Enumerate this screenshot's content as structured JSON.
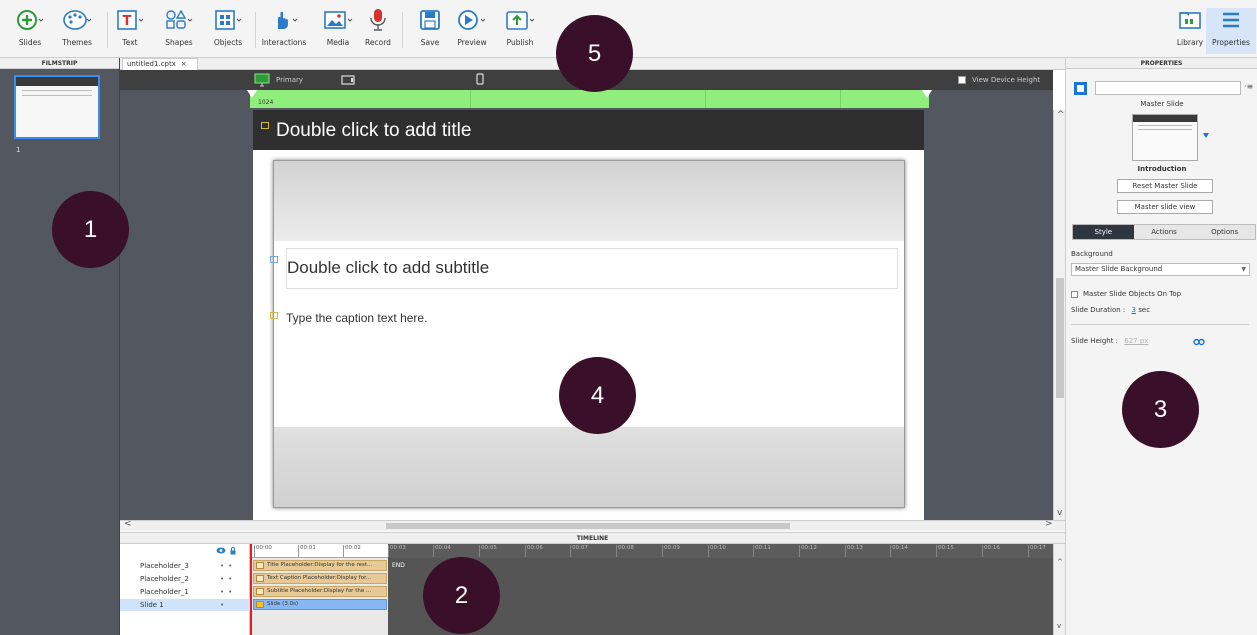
{
  "toolbar": {
    "slides": "Slides",
    "themes": "Themes",
    "text": "Text",
    "shapes": "Shapes",
    "objects": "Objects",
    "interactions": "Interactions",
    "media": "Media",
    "record": "Record",
    "save": "Save",
    "preview": "Preview",
    "publish": "Publish",
    "library": "Library",
    "properties": "Properties"
  },
  "filmstrip": {
    "header": "FILMSTRIP",
    "slide_number": "1"
  },
  "document_tab": {
    "name": "untitled1.cptx",
    "close": "×"
  },
  "device_bar": {
    "primary": "Primary",
    "view_device_height": "View Device Height",
    "width_label": "1024"
  },
  "slide": {
    "title_placeholder": "Double click to add title",
    "subtitle_placeholder": "Double click to add subtitle",
    "caption_placeholder": "Type the caption text here."
  },
  "timeline": {
    "header": "TIMELINE",
    "rows": [
      {
        "label": "Placeholder_3",
        "bar": "Title Placeholder:Display for the rest..."
      },
      {
        "label": "Placeholder_2",
        "bar": "Text Caption Placeholder:Display for..."
      },
      {
        "label": "Placeholder_1",
        "bar": "Subtitle Placeholder:Display for the ..."
      },
      {
        "label": "Slide 1",
        "bar": "Slide (3.0s)"
      }
    ],
    "end_label": "END",
    "ticks": [
      "00:00",
      "00:01",
      "00:02",
      "00:03",
      "00:04",
      "00:05",
      "00:06",
      "00:07",
      "00:08",
      "00:09",
      "00:10",
      "00:11",
      "00:12",
      "00:13",
      "00:14",
      "00:15",
      "00:16",
      "00:17"
    ]
  },
  "properties": {
    "header": "PROPERTIES",
    "object_type": "Master Slide",
    "master_name": "Introduction",
    "reset_button": "Reset Master Slide",
    "master_view_button": "Master slide view",
    "tabs": [
      "Style",
      "Actions",
      "Options"
    ],
    "background_label": "Background",
    "background_value": "Master Slide Background",
    "objects_on_top": "Master Slide Objects On Top",
    "duration_label": "Slide Duration :",
    "duration_value": "3",
    "duration_unit": "sec",
    "height_label": "Slide Height :",
    "height_value": "627 px"
  },
  "callouts": [
    "1",
    "2",
    "3",
    "4",
    "5"
  ],
  "colors": {
    "accent": "#1a73d6",
    "callout": "#3a0f2a",
    "ruler_green": "#90ee7d",
    "stage": "#535860"
  }
}
